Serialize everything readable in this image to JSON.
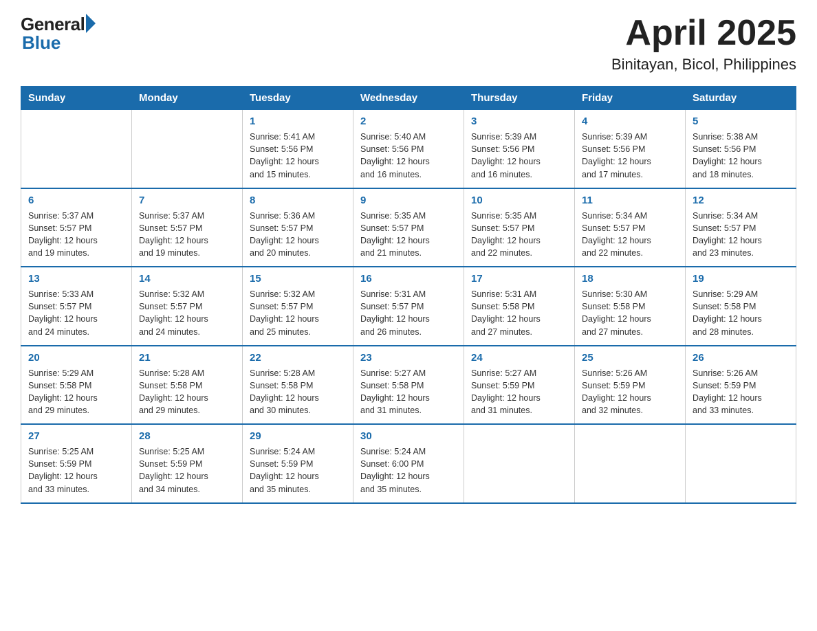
{
  "header": {
    "logo_general": "General",
    "logo_blue": "Blue",
    "title": "April 2025",
    "subtitle": "Binitayan, Bicol, Philippines"
  },
  "calendar": {
    "days_of_week": [
      "Sunday",
      "Monday",
      "Tuesday",
      "Wednesday",
      "Thursday",
      "Friday",
      "Saturday"
    ],
    "weeks": [
      [
        {
          "day": "",
          "info": ""
        },
        {
          "day": "",
          "info": ""
        },
        {
          "day": "1",
          "info": "Sunrise: 5:41 AM\nSunset: 5:56 PM\nDaylight: 12 hours\nand 15 minutes."
        },
        {
          "day": "2",
          "info": "Sunrise: 5:40 AM\nSunset: 5:56 PM\nDaylight: 12 hours\nand 16 minutes."
        },
        {
          "day": "3",
          "info": "Sunrise: 5:39 AM\nSunset: 5:56 PM\nDaylight: 12 hours\nand 16 minutes."
        },
        {
          "day": "4",
          "info": "Sunrise: 5:39 AM\nSunset: 5:56 PM\nDaylight: 12 hours\nand 17 minutes."
        },
        {
          "day": "5",
          "info": "Sunrise: 5:38 AM\nSunset: 5:56 PM\nDaylight: 12 hours\nand 18 minutes."
        }
      ],
      [
        {
          "day": "6",
          "info": "Sunrise: 5:37 AM\nSunset: 5:57 PM\nDaylight: 12 hours\nand 19 minutes."
        },
        {
          "day": "7",
          "info": "Sunrise: 5:37 AM\nSunset: 5:57 PM\nDaylight: 12 hours\nand 19 minutes."
        },
        {
          "day": "8",
          "info": "Sunrise: 5:36 AM\nSunset: 5:57 PM\nDaylight: 12 hours\nand 20 minutes."
        },
        {
          "day": "9",
          "info": "Sunrise: 5:35 AM\nSunset: 5:57 PM\nDaylight: 12 hours\nand 21 minutes."
        },
        {
          "day": "10",
          "info": "Sunrise: 5:35 AM\nSunset: 5:57 PM\nDaylight: 12 hours\nand 22 minutes."
        },
        {
          "day": "11",
          "info": "Sunrise: 5:34 AM\nSunset: 5:57 PM\nDaylight: 12 hours\nand 22 minutes."
        },
        {
          "day": "12",
          "info": "Sunrise: 5:34 AM\nSunset: 5:57 PM\nDaylight: 12 hours\nand 23 minutes."
        }
      ],
      [
        {
          "day": "13",
          "info": "Sunrise: 5:33 AM\nSunset: 5:57 PM\nDaylight: 12 hours\nand 24 minutes."
        },
        {
          "day": "14",
          "info": "Sunrise: 5:32 AM\nSunset: 5:57 PM\nDaylight: 12 hours\nand 24 minutes."
        },
        {
          "day": "15",
          "info": "Sunrise: 5:32 AM\nSunset: 5:57 PM\nDaylight: 12 hours\nand 25 minutes."
        },
        {
          "day": "16",
          "info": "Sunrise: 5:31 AM\nSunset: 5:57 PM\nDaylight: 12 hours\nand 26 minutes."
        },
        {
          "day": "17",
          "info": "Sunrise: 5:31 AM\nSunset: 5:58 PM\nDaylight: 12 hours\nand 27 minutes."
        },
        {
          "day": "18",
          "info": "Sunrise: 5:30 AM\nSunset: 5:58 PM\nDaylight: 12 hours\nand 27 minutes."
        },
        {
          "day": "19",
          "info": "Sunrise: 5:29 AM\nSunset: 5:58 PM\nDaylight: 12 hours\nand 28 minutes."
        }
      ],
      [
        {
          "day": "20",
          "info": "Sunrise: 5:29 AM\nSunset: 5:58 PM\nDaylight: 12 hours\nand 29 minutes."
        },
        {
          "day": "21",
          "info": "Sunrise: 5:28 AM\nSunset: 5:58 PM\nDaylight: 12 hours\nand 29 minutes."
        },
        {
          "day": "22",
          "info": "Sunrise: 5:28 AM\nSunset: 5:58 PM\nDaylight: 12 hours\nand 30 minutes."
        },
        {
          "day": "23",
          "info": "Sunrise: 5:27 AM\nSunset: 5:58 PM\nDaylight: 12 hours\nand 31 minutes."
        },
        {
          "day": "24",
          "info": "Sunrise: 5:27 AM\nSunset: 5:59 PM\nDaylight: 12 hours\nand 31 minutes."
        },
        {
          "day": "25",
          "info": "Sunrise: 5:26 AM\nSunset: 5:59 PM\nDaylight: 12 hours\nand 32 minutes."
        },
        {
          "day": "26",
          "info": "Sunrise: 5:26 AM\nSunset: 5:59 PM\nDaylight: 12 hours\nand 33 minutes."
        }
      ],
      [
        {
          "day": "27",
          "info": "Sunrise: 5:25 AM\nSunset: 5:59 PM\nDaylight: 12 hours\nand 33 minutes."
        },
        {
          "day": "28",
          "info": "Sunrise: 5:25 AM\nSunset: 5:59 PM\nDaylight: 12 hours\nand 34 minutes."
        },
        {
          "day": "29",
          "info": "Sunrise: 5:24 AM\nSunset: 5:59 PM\nDaylight: 12 hours\nand 35 minutes."
        },
        {
          "day": "30",
          "info": "Sunrise: 5:24 AM\nSunset: 6:00 PM\nDaylight: 12 hours\nand 35 minutes."
        },
        {
          "day": "",
          "info": ""
        },
        {
          "day": "",
          "info": ""
        },
        {
          "day": "",
          "info": ""
        }
      ]
    ]
  }
}
